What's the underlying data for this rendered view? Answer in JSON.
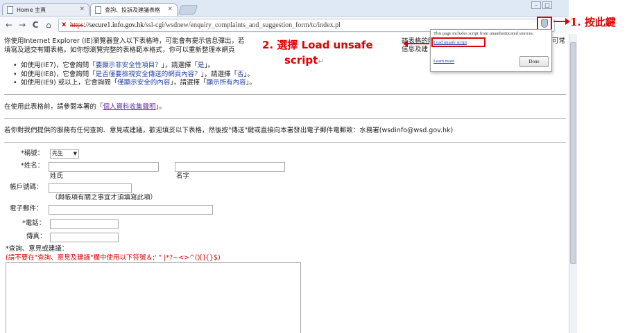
{
  "browser": {
    "tabs": [
      {
        "title": "Home 主頁",
        "close": "×"
      },
      {
        "title": "查詢、投訴及建議表格",
        "close": "×"
      }
    ],
    "window_buttons": [
      "–",
      "□"
    ],
    "nav": {
      "back": "←",
      "forward": "→",
      "reload": "C",
      "home": "⌂"
    },
    "url_scheme": "https",
    "url_host": "://secure1.info.gov.hk",
    "url_path": "/ssl-cgi/wsdnew/enquiry_complaints_and_suggestion_form/tc/index.pl",
    "url_error": "x"
  },
  "annotations": {
    "step1": "1.  按此鍵",
    "step2_line1": "2.  選擇 Load unsafe",
    "step2_line2": "script",
    "step2_mark": "↵",
    "accent_color": "#e00000"
  },
  "popup": {
    "message": "This page includes script from unauthenticated sources.",
    "load_link": "Load unsafe script",
    "learn_more": "Learn more",
    "done_button": "Done"
  },
  "page": {
    "intro_line1": "你使用Internet Explorer (IE)瀏覽器登入以下表格時，可能會有提示信息彈出，若",
    "intro_line2": "填寫及遞交有關表格。如你想瀏覽完整的表格範本格式，你可以重新整理本網頁",
    "intro_tail_line1": "該表格的時",
    "intro_tail_line2": "信息及建",
    "intro_tail_line1_end": "可常",
    "bullets": [
      {
        "pre": "如使用(IE7)，它會詢問「",
        "hl": "要顯示非安全性項目？",
        "post": "」，請選擇「",
        "hl2": "是",
        "end": "」。"
      },
      {
        "pre": "如使用(IE8)，它會詢問「",
        "hl": "是否僅要檢視安全傳送的網頁內容？",
        "post": "」，請選擇「",
        "hl2": "否",
        "end": "」。"
      },
      {
        "pre": "如使用(IE9) 或以上，它會詢問「",
        "hl": "僅顯示安全的內容",
        "post": "」，請選擇「",
        "hl2": "顯示所有內容",
        "end": "」。"
      }
    ],
    "privacy_pre": "在使用此表格前，請參閱本署的「",
    "privacy_link": "個人資料收集聲明",
    "privacy_post": "」。",
    "instruction": "若你對我們提供的服務有任何查詢、意見或建議，歡迎填妥以下表格，然後按\"傳送\"鍵或直接向本署發出電子郵件電郵致：水務署(wsdinfo@wsd.gov.hk)"
  },
  "form": {
    "title_label": "*稱號：",
    "title_value": "先生",
    "name_label": "*姓名：",
    "surname_sub": "姓氏",
    "given_sub": "名字",
    "account_label": "帳戶號碼：",
    "account_note": "（與帳項有關之事宜才須填寫此項）",
    "email_label": "電子郵件：",
    "phone_label": "*電話：",
    "fax_label": "傳真：",
    "comments_label": "*查詢、意見或建議：",
    "comments_warning": "(請不要在\"查詢、意見及建議\"欄中使用以下符號＆;' \" |*?~<>^()[]{}$)"
  }
}
